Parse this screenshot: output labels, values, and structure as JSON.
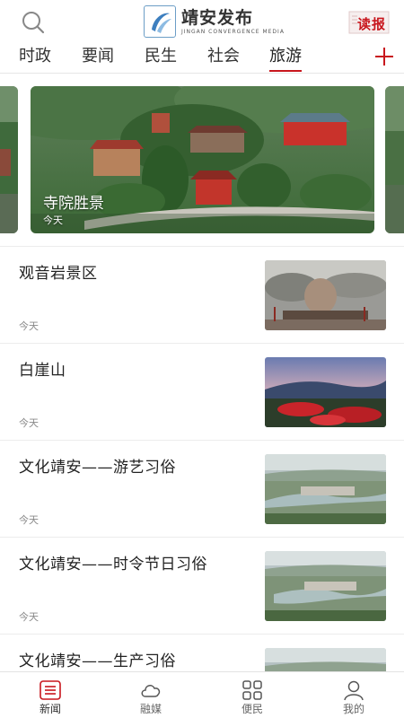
{
  "header": {
    "logo_cn": "靖安发布",
    "logo_en": "JINGAN CONVERGENCE MEDIA",
    "read_label": "读报"
  },
  "tabs": [
    {
      "label": "时政",
      "active": false
    },
    {
      "label": "要闻",
      "active": false
    },
    {
      "label": "民生",
      "active": false
    },
    {
      "label": "社会",
      "active": false
    },
    {
      "label": "旅游",
      "active": true
    }
  ],
  "carousel": {
    "title": "寺院胜景",
    "time": "今天"
  },
  "news": [
    {
      "title": "观音岩景区",
      "time": "今天"
    },
    {
      "title": "白崖山",
      "time": "今天"
    },
    {
      "title": "文化靖安——游艺习俗",
      "time": "今天"
    },
    {
      "title": "文化靖安——时令节日习俗",
      "time": "今天"
    },
    {
      "title": "文化靖安——生产习俗",
      "time": ""
    }
  ],
  "bottom_nav": [
    {
      "label": "新闻",
      "icon": "news-icon",
      "active": true
    },
    {
      "label": "融媒",
      "icon": "cloud-icon",
      "active": false
    },
    {
      "label": "便民",
      "icon": "grid-icon",
      "active": false
    },
    {
      "label": "我的",
      "icon": "user-icon",
      "active": false
    }
  ],
  "colors": {
    "accent": "#c8161d",
    "text": "#222222",
    "muted": "#888888"
  }
}
